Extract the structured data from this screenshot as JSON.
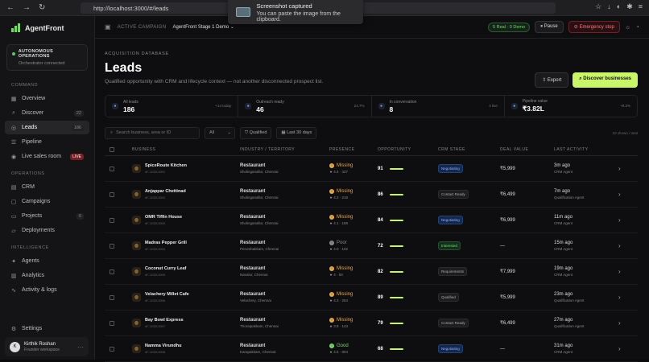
{
  "browser": {
    "url": "http://localhost:3000/#/leads"
  },
  "toast": {
    "title": "Screenshot captured",
    "message": "You can paste the image from the clipboard."
  },
  "sidebar": {
    "brand": "AgentFront",
    "auto_title": "AUTONOMOUS OPERATIONS",
    "auto_sub": "Orchestrator connected",
    "sections": {
      "command": "COMMAND",
      "operations": "OPERATIONS",
      "intelligence": "INTELLIGENCE"
    },
    "items": {
      "overview": "Overview",
      "discover": "Discover",
      "discover_count": "22",
      "leads": "Leads",
      "leads_count": "186",
      "pipeline": "Pipeline",
      "live": "Live sales room",
      "live_badge": "LIVE",
      "crm": "CRM",
      "campaigns": "Campaigns",
      "projects": "Projects",
      "projects_count": "6",
      "deployments": "Deployments",
      "agents": "Agents",
      "analytics": "Analytics",
      "activity": "Activity & logs",
      "settings": "Settings"
    },
    "user": {
      "initial": "K",
      "name": "Kirthik Roshan",
      "role": "Founder workspace"
    }
  },
  "topbar": {
    "label": "ACTIVE CAMPAIGN",
    "campaign": "AgentFront Stage 1 Demo",
    "status": "5 Real · 0 Demo",
    "pause": "Pause",
    "emergency": "Emergency stop"
  },
  "header": {
    "kicker": "ACQUISITION DATABASE",
    "title": "Leads",
    "subtitle": "Qualified opportunity with CRM and lifecycle context — not another disconnected prospect list.",
    "export": "Export",
    "discover": "Discover businesses"
  },
  "stats": [
    {
      "label": "All leads",
      "value": "186",
      "delta": "+14 today"
    },
    {
      "label": "Outreach ready",
      "value": "46",
      "delta": "24.7%"
    },
    {
      "label": "In conversation",
      "value": "8",
      "delta": "4 live"
    },
    {
      "label": "Pipeline value",
      "value": "₹3.82L",
      "delta": "+8.2%"
    }
  ],
  "filters": {
    "search_placeholder": "Search business, area or ID",
    "all": "All",
    "qualified": "Qualified",
    "last30": "Last 30 days",
    "count": "10 shown / total"
  },
  "columns": {
    "business": "BUSINESS",
    "industry": "INDUSTRY / TERRITORY",
    "presence": "PRESENCE",
    "opportunity": "OPPORTUNITY",
    "crm": "CRM STAGE",
    "deal": "DEAL VALUE",
    "activity": "LAST ACTIVITY"
  },
  "rows": [
    {
      "name": "SpiceRoute Kitchen",
      "id": "#F-1025-0001",
      "industry": "Restaurant",
      "loc": "Sholinganallur, Chennai",
      "presence": "Missing",
      "rating": "4.4 · 427",
      "score": "91",
      "stage": "Negotiating",
      "stage_type": "neg",
      "deal": "₹5,999",
      "time": "3m ago",
      "agent": "CRM Agent"
    },
    {
      "name": "Anjappar Chettinad",
      "id": "#F-1025-0002",
      "industry": "Restaurant",
      "loc": "Sholinganallur, Chennai",
      "presence": "Missing",
      "rating": "4.2 · 218",
      "score": "86",
      "stage": "Contact Ready",
      "stage_type": "ctc",
      "deal": "₹6,499",
      "time": "7m ago",
      "agent": "Qualification Agent"
    },
    {
      "name": "OMR Tiffin House",
      "id": "#F-1025-0003",
      "industry": "Restaurant",
      "loc": "Sholinganallur, Chennai",
      "presence": "Missing",
      "rating": "4.1 · 188",
      "score": "84",
      "stage": "Negotiating",
      "stage_type": "neg",
      "deal": "₹6,999",
      "time": "11m ago",
      "agent": "CRM Agent"
    },
    {
      "name": "Madras Pepper Grill",
      "id": "#F-1025-0004",
      "industry": "Restaurant",
      "loc": "Perumbakkam, Chennai",
      "presence": "Poor",
      "rating": "4.0 · 102",
      "score": "72",
      "stage": "Interested",
      "stage_type": "int",
      "deal": "—",
      "time": "15m ago",
      "agent": "CRM Agent"
    },
    {
      "name": "Coconut Curry Leaf",
      "id": "#F-1025-0005",
      "industry": "Restaurant",
      "loc": "Navalur, Chennai",
      "presence": "Missing",
      "rating": "4 · 93",
      "score": "82",
      "stage": "Requirements",
      "stage_type": "req",
      "deal": "₹7,999",
      "time": "19m ago",
      "agent": "CRM Agent"
    },
    {
      "name": "Velachery Millet Cafe",
      "id": "#F-1025-0006",
      "industry": "Restaurant",
      "loc": "Velachery, Chennai",
      "presence": "Missing",
      "rating": "4.3 · 254",
      "score": "89",
      "stage": "Qualified",
      "stage_type": "qual",
      "deal": "₹5,999",
      "time": "23m ago",
      "agent": "Qualification Agent"
    },
    {
      "name": "Bay Bowl Express",
      "id": "#F-1025-0007",
      "industry": "Restaurant",
      "loc": "Thoraipakkam, Chennai",
      "presence": "Missing",
      "rating": "3.9 · 143",
      "score": "79",
      "stage": "Contact Ready",
      "stage_type": "ctc",
      "deal": "₹6,499",
      "time": "27m ago",
      "agent": "Qualification Agent"
    },
    {
      "name": "Namma Virundhu",
      "id": "#F-1025-0008",
      "industry": "Restaurant",
      "loc": "Karapakkam, Chennai",
      "presence": "Good",
      "rating": "4.6 · 804",
      "score": "68",
      "stage": "Negotiating",
      "stage_type": "neg",
      "deal": "—",
      "time": "31m ago",
      "agent": "CRM Agent"
    }
  ]
}
